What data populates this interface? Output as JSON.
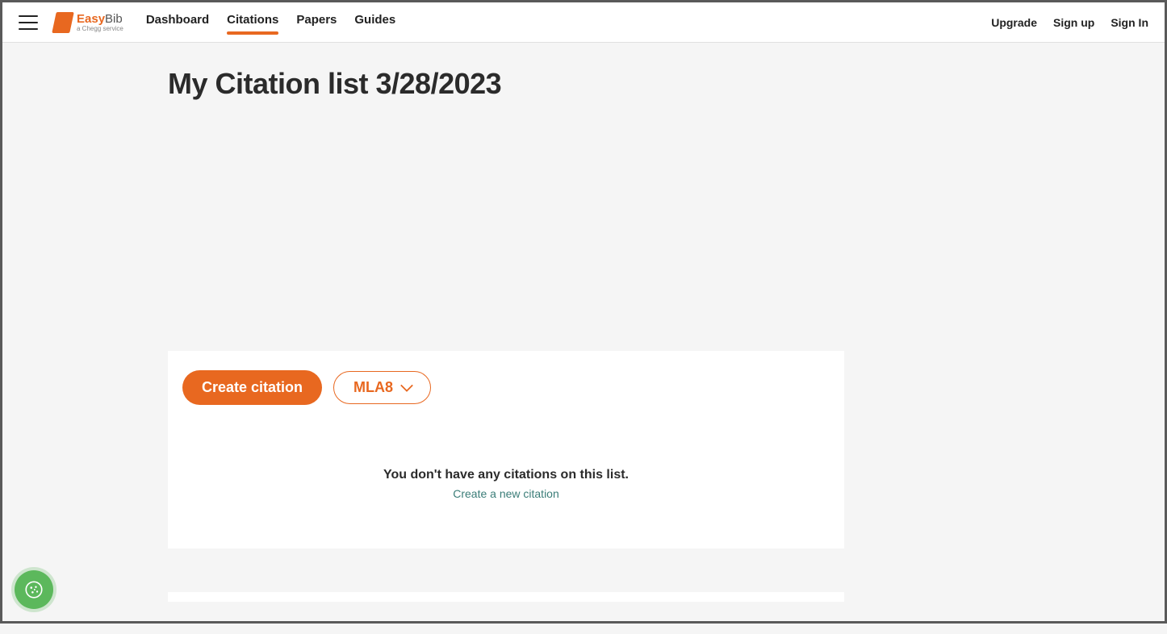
{
  "brand": {
    "name_prefix": "Easy",
    "name_suffix": "Bib",
    "tagline": "a Chegg service"
  },
  "nav": {
    "items": [
      {
        "label": "Dashboard",
        "active": false
      },
      {
        "label": "Citations",
        "active": true
      },
      {
        "label": "Papers",
        "active": false
      },
      {
        "label": "Guides",
        "active": false
      }
    ]
  },
  "header_links": {
    "upgrade": "Upgrade",
    "signup": "Sign up",
    "signin": "Sign In"
  },
  "page": {
    "title": "My Citation list 3/28/2023"
  },
  "actions": {
    "create_citation": "Create citation",
    "style_selector": "MLA8"
  },
  "empty": {
    "title": "You don't have any citations on this list.",
    "link": "Create a new citation"
  },
  "cookie_icon": "cookie-icon"
}
